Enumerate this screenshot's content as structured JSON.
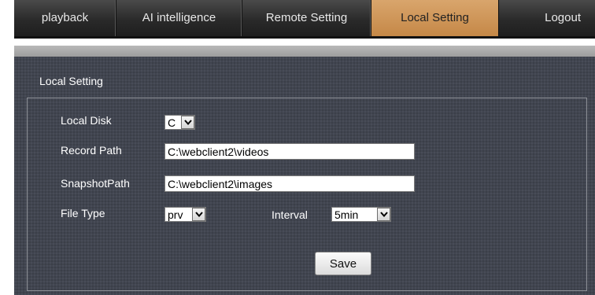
{
  "nav": {
    "tabs": [
      {
        "label": "playback",
        "active": false
      },
      {
        "label": "AI intelligence",
        "active": false
      },
      {
        "label": "Remote Setting",
        "active": false
      },
      {
        "label": "Local Setting",
        "active": true
      },
      {
        "label": "Logout",
        "active": false
      }
    ]
  },
  "section": {
    "title": "Local Setting"
  },
  "form": {
    "local_disk": {
      "label": "Local Disk",
      "value": "C"
    },
    "record_path": {
      "label": "Record Path",
      "value": "C:\\webclient2\\videos"
    },
    "snapshot_path": {
      "label": "SnapshotPath",
      "value": "C:\\webclient2\\images"
    },
    "file_type": {
      "label": "File Type",
      "value": "prv"
    },
    "interval": {
      "label": "Interval",
      "value": "5min"
    },
    "save_label": "Save"
  },
  "colors": {
    "active_tab": "#c58847",
    "nav_background": "#2a2a2a",
    "content_background": "#414550"
  },
  "icons": {
    "dropdown": "chevron-down-icon"
  }
}
